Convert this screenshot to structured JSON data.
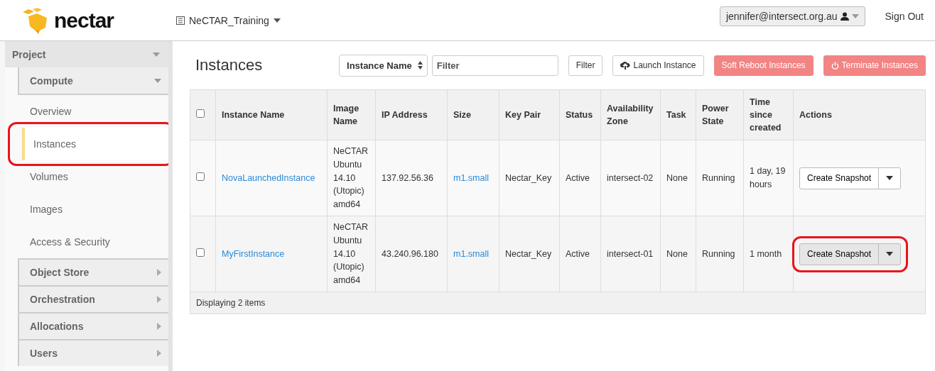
{
  "header": {
    "logo_text": "nectar",
    "project_switcher": "NeCTAR_Training",
    "user_menu": "jennifer@intersect.org.au",
    "sign_out": "Sign Out"
  },
  "sidebar": {
    "panel": {
      "label": "Project",
      "expanded": true
    },
    "group": {
      "label": "Compute",
      "expanded": true
    },
    "items": [
      {
        "label": "Overview",
        "selected": false,
        "circled": false
      },
      {
        "label": "Instances",
        "selected": true,
        "circled": true
      },
      {
        "label": "Volumes",
        "selected": false,
        "circled": false
      },
      {
        "label": "Images",
        "selected": false,
        "circled": false
      },
      {
        "label": "Access & Security",
        "selected": false,
        "circled": false
      }
    ],
    "collapsed_groups": [
      {
        "label": "Object Store",
        "expanded": false
      },
      {
        "label": "Orchestration",
        "expanded": false
      },
      {
        "label": "Allocations",
        "expanded": false
      },
      {
        "label": "Users",
        "expanded": false
      }
    ]
  },
  "page": {
    "title": "Instances",
    "filter_field_select": "Instance Name",
    "filter_placeholder": "Filter",
    "buttons": [
      {
        "label": "Filter",
        "kind": "plain"
      },
      {
        "label": "Launch Instance",
        "kind": "launch"
      },
      {
        "label": "Soft Reboot Instances",
        "kind": "danger"
      },
      {
        "label": "Terminate Instances",
        "kind": "terminate"
      }
    ]
  },
  "table": {
    "select_all_checked": false,
    "columns": [
      "Instance Name",
      "Image Name",
      "IP Address",
      "Size",
      "Key Pair",
      "Status",
      "Availability Zone",
      "Task",
      "Power State",
      "Time since created",
      "Actions"
    ],
    "rows": [
      {
        "checked": false,
        "name": "NovaLaunchedInstance",
        "image": "NeCTAR Ubuntu 14.10 (Utopic) amd64",
        "ip": "137.92.56.36",
        "size": "m1.small",
        "key_pair": "Nectar_Key",
        "status": "Active",
        "zone": "intersect-02",
        "task": "None",
        "power": "Running",
        "age": "1 day, 19 hours",
        "action": "Create Snapshot",
        "action_pressed": false,
        "circled": false
      },
      {
        "checked": false,
        "name": "MyFirstInstance",
        "image": "NeCTAR Ubuntu 14.10 (Utopic) amd64",
        "ip": "43.240.96.180",
        "size": "m1.small",
        "key_pair": "Nectar_Key",
        "status": "Active",
        "zone": "intersect-01",
        "task": "None",
        "power": "Running",
        "age": "1 month",
        "action": "Create Snapshot",
        "action_pressed": true,
        "circled": true
      }
    ],
    "footer": "Displaying 2 items"
  }
}
